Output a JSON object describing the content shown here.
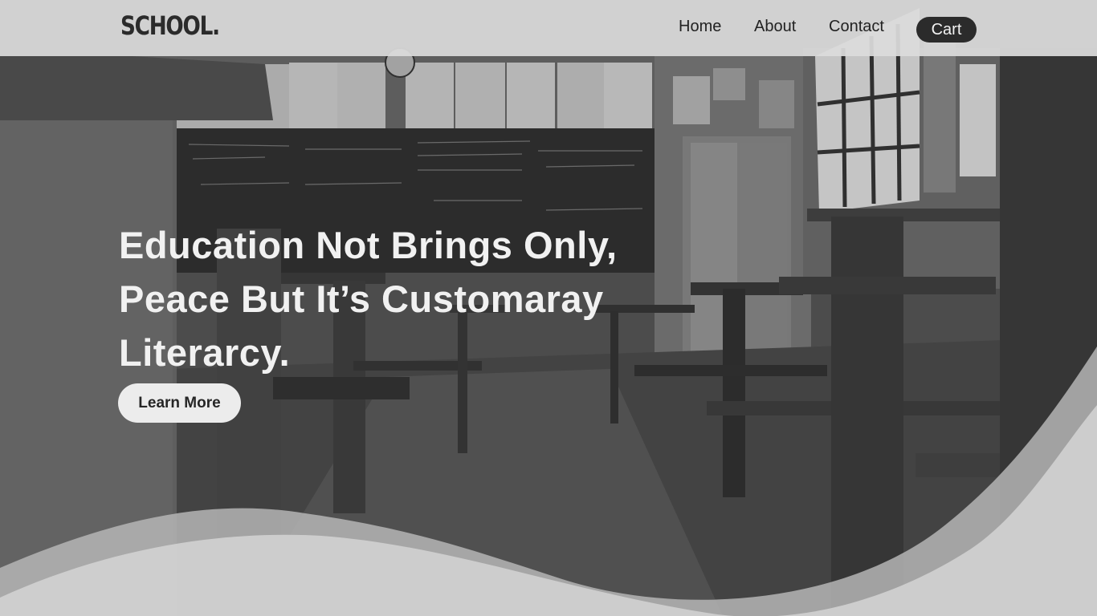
{
  "header": {
    "logo": "SCHOOL.",
    "nav": {
      "home": "Home",
      "about": "About",
      "contact": "Contact",
      "cart": "Cart"
    }
  },
  "hero": {
    "headline_lines": [
      "Education Not Brings Only,",
      "Peace But It’s Customaray",
      "Literarcy."
    ],
    "cta_label": "Learn More",
    "background": "classroom-photo-grayscale"
  },
  "colors": {
    "nav_bg": "#dcdcdc",
    "cart_bg": "#2b2b2b",
    "headline": "#f1f1f1",
    "button_bg": "#ececec",
    "wave_light": "#d0d0d0",
    "wave_mid": "#b4b4b4"
  }
}
